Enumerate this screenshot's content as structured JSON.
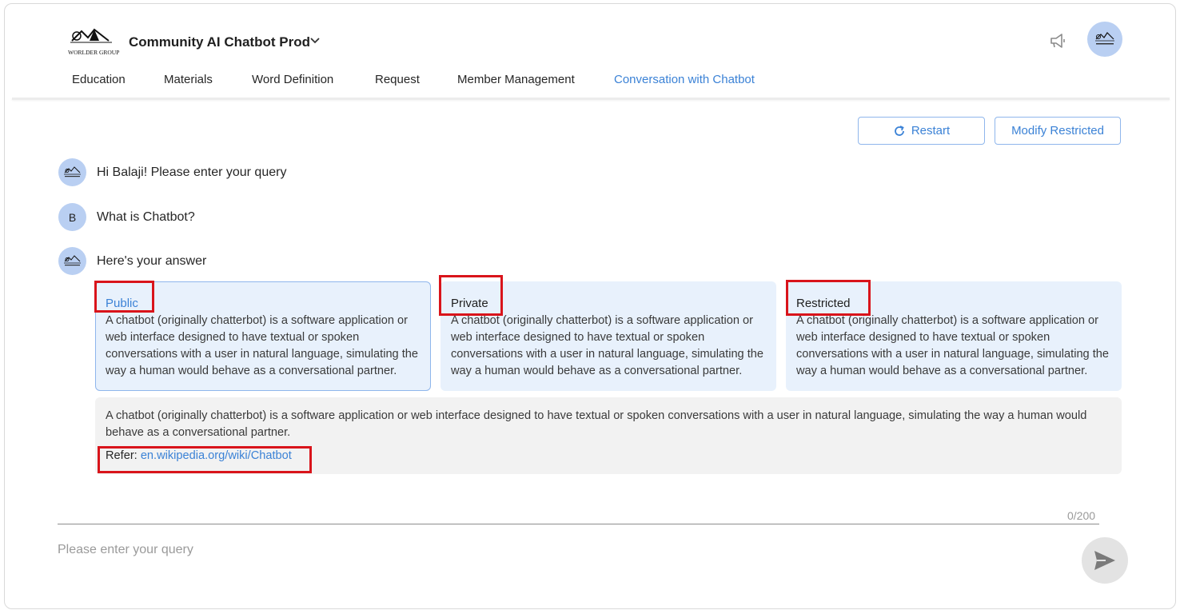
{
  "header": {
    "logo_text": "WORLDER GROUP",
    "app_title": "Community AI Chatbot Prod"
  },
  "tabs": [
    {
      "label": "Education"
    },
    {
      "label": "Materials"
    },
    {
      "label": "Word Definition"
    },
    {
      "label": "Request"
    },
    {
      "label": "Member Management"
    },
    {
      "label": "Conversation with Chatbot",
      "active": true
    }
  ],
  "actions": {
    "restart_label": "Restart",
    "modify_label": "Modify Restricted"
  },
  "messages": {
    "greeting": "Hi Balaji! Please enter your query",
    "user_initial": "B",
    "user_question": "What is Chatbot?",
    "bot_answer_intro": "Here's your answer"
  },
  "cards": [
    {
      "title": "Public",
      "body": "A chatbot (originally chatterbot) is a software application or web interface designed to have textual or spoken conversations with a user in natural language, simulating the way a human would behave as a conversational partner.",
      "selected": true
    },
    {
      "title": "Private",
      "body": "A chatbot (originally chatterbot) is a software application or web interface designed to have textual or spoken conversations with a user in natural language, simulating the way a human would behave as a conversational partner."
    },
    {
      "title": "Restricted",
      "body": "A chatbot (originally chatterbot) is a software application or web interface designed to have textual or spoken conversations with a user in natural language, simulating the way a human would behave as a conversational partner."
    }
  ],
  "summary": {
    "text": "A chatbot (originally chatterbot) is a software application or web interface designed to have textual or spoken conversations with a user in natural language, simulating the way a human would behave as a conversational partner.",
    "refer_label": "Refer:",
    "refer_link": "en.wikipedia.org/wiki/Chatbot"
  },
  "input": {
    "placeholder": "Please enter your query",
    "counter": "0/200"
  },
  "colors": {
    "accent": "#3b82d6",
    "card_bg": "#e8f1fc",
    "highlight": "#d9141b",
    "avatar_bg": "#b9cff2"
  }
}
